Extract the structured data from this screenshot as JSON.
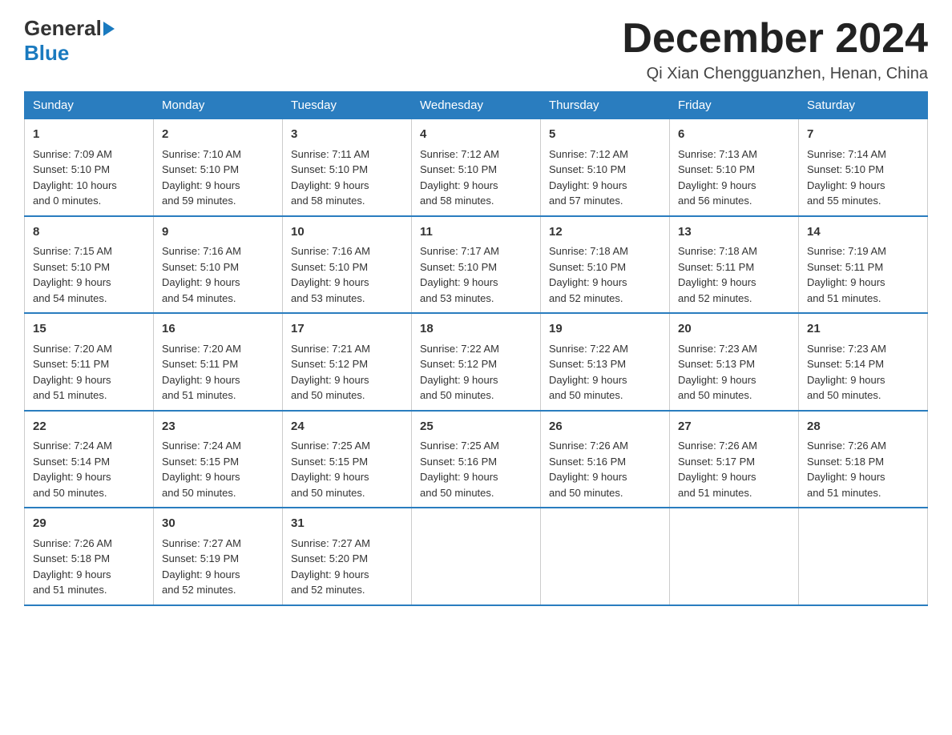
{
  "logo": {
    "general": "General",
    "blue": "Blue"
  },
  "title": "December 2024",
  "location": "Qi Xian Chengguanzhen, Henan, China",
  "days_header": [
    "Sunday",
    "Monday",
    "Tuesday",
    "Wednesday",
    "Thursday",
    "Friday",
    "Saturday"
  ],
  "weeks": [
    [
      {
        "day": "1",
        "sunrise": "7:09 AM",
        "sunset": "5:10 PM",
        "daylight": "10 hours and 0 minutes."
      },
      {
        "day": "2",
        "sunrise": "7:10 AM",
        "sunset": "5:10 PM",
        "daylight": "9 hours and 59 minutes."
      },
      {
        "day": "3",
        "sunrise": "7:11 AM",
        "sunset": "5:10 PM",
        "daylight": "9 hours and 58 minutes."
      },
      {
        "day": "4",
        "sunrise": "7:12 AM",
        "sunset": "5:10 PM",
        "daylight": "9 hours and 58 minutes."
      },
      {
        "day": "5",
        "sunrise": "7:12 AM",
        "sunset": "5:10 PM",
        "daylight": "9 hours and 57 minutes."
      },
      {
        "day": "6",
        "sunrise": "7:13 AM",
        "sunset": "5:10 PM",
        "daylight": "9 hours and 56 minutes."
      },
      {
        "day": "7",
        "sunrise": "7:14 AM",
        "sunset": "5:10 PM",
        "daylight": "9 hours and 55 minutes."
      }
    ],
    [
      {
        "day": "8",
        "sunrise": "7:15 AM",
        "sunset": "5:10 PM",
        "daylight": "9 hours and 54 minutes."
      },
      {
        "day": "9",
        "sunrise": "7:16 AM",
        "sunset": "5:10 PM",
        "daylight": "9 hours and 54 minutes."
      },
      {
        "day": "10",
        "sunrise": "7:16 AM",
        "sunset": "5:10 PM",
        "daylight": "9 hours and 53 minutes."
      },
      {
        "day": "11",
        "sunrise": "7:17 AM",
        "sunset": "5:10 PM",
        "daylight": "9 hours and 53 minutes."
      },
      {
        "day": "12",
        "sunrise": "7:18 AM",
        "sunset": "5:10 PM",
        "daylight": "9 hours and 52 minutes."
      },
      {
        "day": "13",
        "sunrise": "7:18 AM",
        "sunset": "5:11 PM",
        "daylight": "9 hours and 52 minutes."
      },
      {
        "day": "14",
        "sunrise": "7:19 AM",
        "sunset": "5:11 PM",
        "daylight": "9 hours and 51 minutes."
      }
    ],
    [
      {
        "day": "15",
        "sunrise": "7:20 AM",
        "sunset": "5:11 PM",
        "daylight": "9 hours and 51 minutes."
      },
      {
        "day": "16",
        "sunrise": "7:20 AM",
        "sunset": "5:11 PM",
        "daylight": "9 hours and 51 minutes."
      },
      {
        "day": "17",
        "sunrise": "7:21 AM",
        "sunset": "5:12 PM",
        "daylight": "9 hours and 50 minutes."
      },
      {
        "day": "18",
        "sunrise": "7:22 AM",
        "sunset": "5:12 PM",
        "daylight": "9 hours and 50 minutes."
      },
      {
        "day": "19",
        "sunrise": "7:22 AM",
        "sunset": "5:13 PM",
        "daylight": "9 hours and 50 minutes."
      },
      {
        "day": "20",
        "sunrise": "7:23 AM",
        "sunset": "5:13 PM",
        "daylight": "9 hours and 50 minutes."
      },
      {
        "day": "21",
        "sunrise": "7:23 AM",
        "sunset": "5:14 PM",
        "daylight": "9 hours and 50 minutes."
      }
    ],
    [
      {
        "day": "22",
        "sunrise": "7:24 AM",
        "sunset": "5:14 PM",
        "daylight": "9 hours and 50 minutes."
      },
      {
        "day": "23",
        "sunrise": "7:24 AM",
        "sunset": "5:15 PM",
        "daylight": "9 hours and 50 minutes."
      },
      {
        "day": "24",
        "sunrise": "7:25 AM",
        "sunset": "5:15 PM",
        "daylight": "9 hours and 50 minutes."
      },
      {
        "day": "25",
        "sunrise": "7:25 AM",
        "sunset": "5:16 PM",
        "daylight": "9 hours and 50 minutes."
      },
      {
        "day": "26",
        "sunrise": "7:26 AM",
        "sunset": "5:16 PM",
        "daylight": "9 hours and 50 minutes."
      },
      {
        "day": "27",
        "sunrise": "7:26 AM",
        "sunset": "5:17 PM",
        "daylight": "9 hours and 51 minutes."
      },
      {
        "day": "28",
        "sunrise": "7:26 AM",
        "sunset": "5:18 PM",
        "daylight": "9 hours and 51 minutes."
      }
    ],
    [
      {
        "day": "29",
        "sunrise": "7:26 AM",
        "sunset": "5:18 PM",
        "daylight": "9 hours and 51 minutes."
      },
      {
        "day": "30",
        "sunrise": "7:27 AM",
        "sunset": "5:19 PM",
        "daylight": "9 hours and 52 minutes."
      },
      {
        "day": "31",
        "sunrise": "7:27 AM",
        "sunset": "5:20 PM",
        "daylight": "9 hours and 52 minutes."
      },
      null,
      null,
      null,
      null
    ]
  ],
  "labels": {
    "sunrise": "Sunrise:",
    "sunset": "Sunset:",
    "daylight": "Daylight:"
  }
}
